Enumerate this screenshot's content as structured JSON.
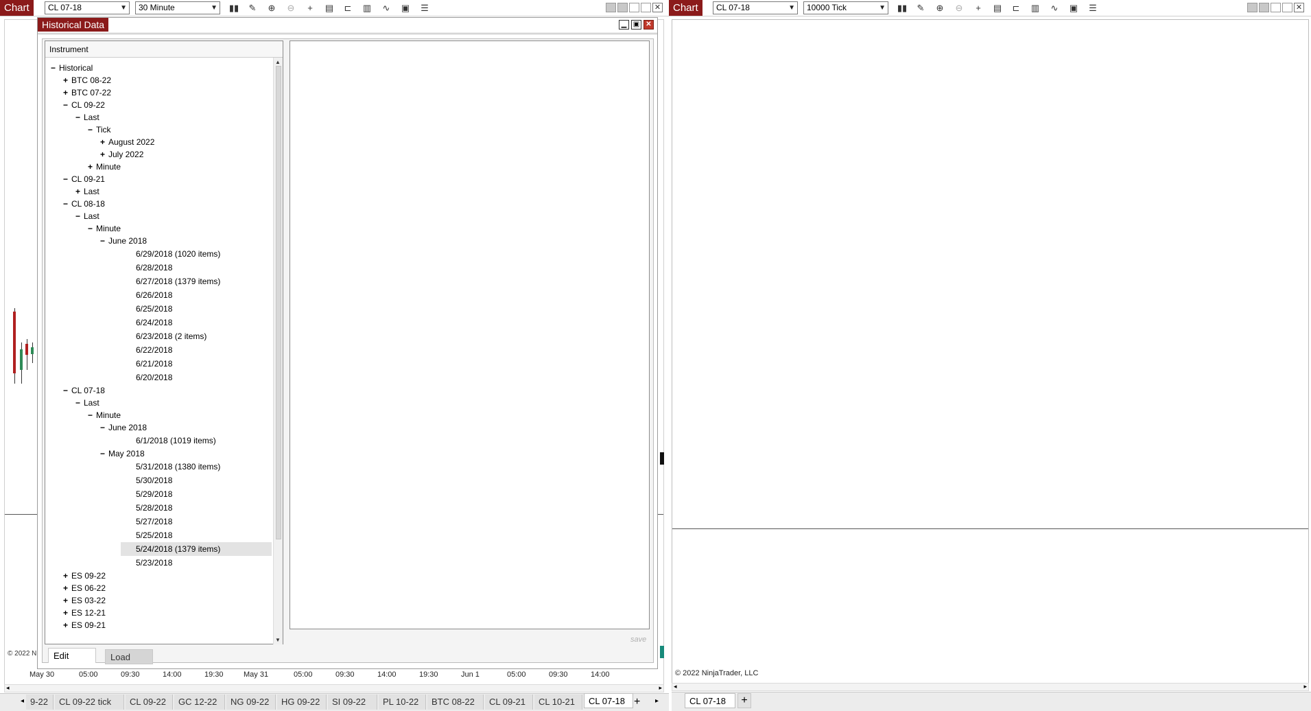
{
  "left_window": {
    "title": "Chart",
    "instrument": "CL 07-18",
    "interval": "30 Minute"
  },
  "right_window": {
    "title": "Chart",
    "instrument": "CL 07-18",
    "interval": "10000 Tick",
    "copyright": "© 2022 NinjaTrader, LLC",
    "tab": "CL 07-18",
    "add_tab": "+"
  },
  "dialog": {
    "title": "Historical Data",
    "tree_header": "Instrument",
    "save_label": "save",
    "tabs": [
      "Edit",
      "Load"
    ],
    "tree": [
      {
        "exp": "−",
        "text": "Historical",
        "level": 0
      },
      {
        "exp": "+",
        "text": "BTC 08-22",
        "level": 1
      },
      {
        "exp": "+",
        "text": "BTC 07-22",
        "level": 1
      },
      {
        "exp": "−",
        "text": "CL 09-22",
        "level": 1
      },
      {
        "exp": "−",
        "text": "Last",
        "level": 2
      },
      {
        "exp": "−",
        "text": "Tick",
        "level": 3
      },
      {
        "exp": "+",
        "text": "August 2022",
        "level": 4
      },
      {
        "exp": "+",
        "text": "July 2022",
        "level": 4
      },
      {
        "exp": "+",
        "text": "Minute",
        "level": 3
      },
      {
        "exp": "−",
        "text": "CL 09-21",
        "level": 1
      },
      {
        "exp": "+",
        "text": "Last",
        "level": 2
      },
      {
        "exp": "−",
        "text": "CL 08-18",
        "level": 1
      },
      {
        "exp": "−",
        "text": "Last",
        "level": 2
      },
      {
        "exp": "−",
        "text": "Minute",
        "level": 3
      },
      {
        "exp": "−",
        "text": "June 2018",
        "level": 4
      },
      {
        "exp": "",
        "text": "6/29/2018 (1020 items)",
        "level": 5
      },
      {
        "exp": "",
        "text": "6/28/2018",
        "level": 5
      },
      {
        "exp": "",
        "text": "6/27/2018 (1379 items)",
        "level": 5
      },
      {
        "exp": "",
        "text": "6/26/2018",
        "level": 5
      },
      {
        "exp": "",
        "text": "6/25/2018",
        "level": 5
      },
      {
        "exp": "",
        "text": "6/24/2018",
        "level": 5
      },
      {
        "exp": "",
        "text": "6/23/2018 (2 items)",
        "level": 5
      },
      {
        "exp": "",
        "text": "6/22/2018",
        "level": 5
      },
      {
        "exp": "",
        "text": "6/21/2018",
        "level": 5
      },
      {
        "exp": "",
        "text": "6/20/2018",
        "level": 5
      },
      {
        "exp": "−",
        "text": "CL 07-18",
        "level": 1
      },
      {
        "exp": "−",
        "text": "Last",
        "level": 2
      },
      {
        "exp": "−",
        "text": "Minute",
        "level": 3
      },
      {
        "exp": "−",
        "text": "June 2018",
        "level": 4
      },
      {
        "exp": "",
        "text": "6/1/2018 (1019 items)",
        "level": 5
      },
      {
        "exp": "−",
        "text": "May 2018",
        "level": 4
      },
      {
        "exp": "",
        "text": "5/31/2018 (1380 items)",
        "level": 5
      },
      {
        "exp": "",
        "text": "5/30/2018",
        "level": 5
      },
      {
        "exp": "",
        "text": "5/29/2018",
        "level": 5
      },
      {
        "exp": "",
        "text": "5/28/2018",
        "level": 5
      },
      {
        "exp": "",
        "text": "5/27/2018",
        "level": 5
      },
      {
        "exp": "",
        "text": "5/25/2018",
        "level": 5
      },
      {
        "exp": "",
        "text": "5/24/2018 (1379 items)",
        "level": 5,
        "selected": true
      },
      {
        "exp": "",
        "text": "5/23/2018",
        "level": 5
      },
      {
        "exp": "+",
        "text": "ES 09-22",
        "level": 1
      },
      {
        "exp": "+",
        "text": "ES 06-22",
        "level": 1
      },
      {
        "exp": "+",
        "text": "ES 03-22",
        "level": 1
      },
      {
        "exp": "+",
        "text": "ES 12-21",
        "level": 1
      },
      {
        "exp": "+",
        "text": "ES 09-21",
        "level": 1
      }
    ]
  },
  "time_axis": [
    "May 30",
    "05:00",
    "09:30",
    "14:00",
    "19:30",
    "May 31",
    "05:00",
    "09:30",
    "14:00",
    "19:30",
    "Jun 1",
    "05:00",
    "09:30",
    "14:00"
  ],
  "left_copyright": "© 2022 N",
  "bottom_tabs": [
    "9-22",
    "CL 09-22 tick",
    "CL 09-22",
    "GC 12-22",
    "NG 09-22",
    "HG 09-22",
    "SI 09-22",
    "PL 10-22",
    "BTC 08-22",
    "CL 09-21",
    "CL 10-21",
    "CL 07-18"
  ],
  "bottom_add_tab": "+",
  "colors": {
    "brand": "#8b1a1a",
    "selection": "#e3e3e3",
    "candle_down": "#b02020",
    "candle_up": "#2e8b57"
  }
}
